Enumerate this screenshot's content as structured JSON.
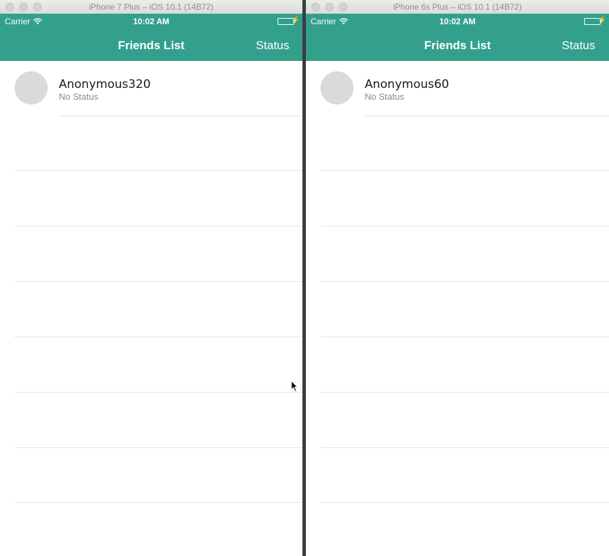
{
  "windows": [
    {
      "title": "iPhone 7 Plus – iOS 10.1 (14B72)",
      "carrier": "Carrier",
      "time": "10:02 AM",
      "nav_title": "Friends List",
      "nav_right": "Status",
      "friends": [
        {
          "name": "Anonymous320",
          "status": "No Status"
        }
      ]
    },
    {
      "title": "iPhone 6s Plus – iOS 10.1 (14B72)",
      "carrier": "Carrier",
      "time": "10:02 AM",
      "nav_title": "Friends List",
      "nav_right": "Status",
      "friends": [
        {
          "name": "Anonymous60",
          "status": "No Status"
        }
      ]
    }
  ],
  "colors": {
    "accent": "#33a08c",
    "avatar_placeholder": "#d9dbdb",
    "separator": "#e4e4e4",
    "secondary_text": "#8b8b8b"
  },
  "icons": [
    "wifi-icon",
    "battery-icon",
    "charging-bolt-icon",
    "mouse-cursor-icon"
  ]
}
